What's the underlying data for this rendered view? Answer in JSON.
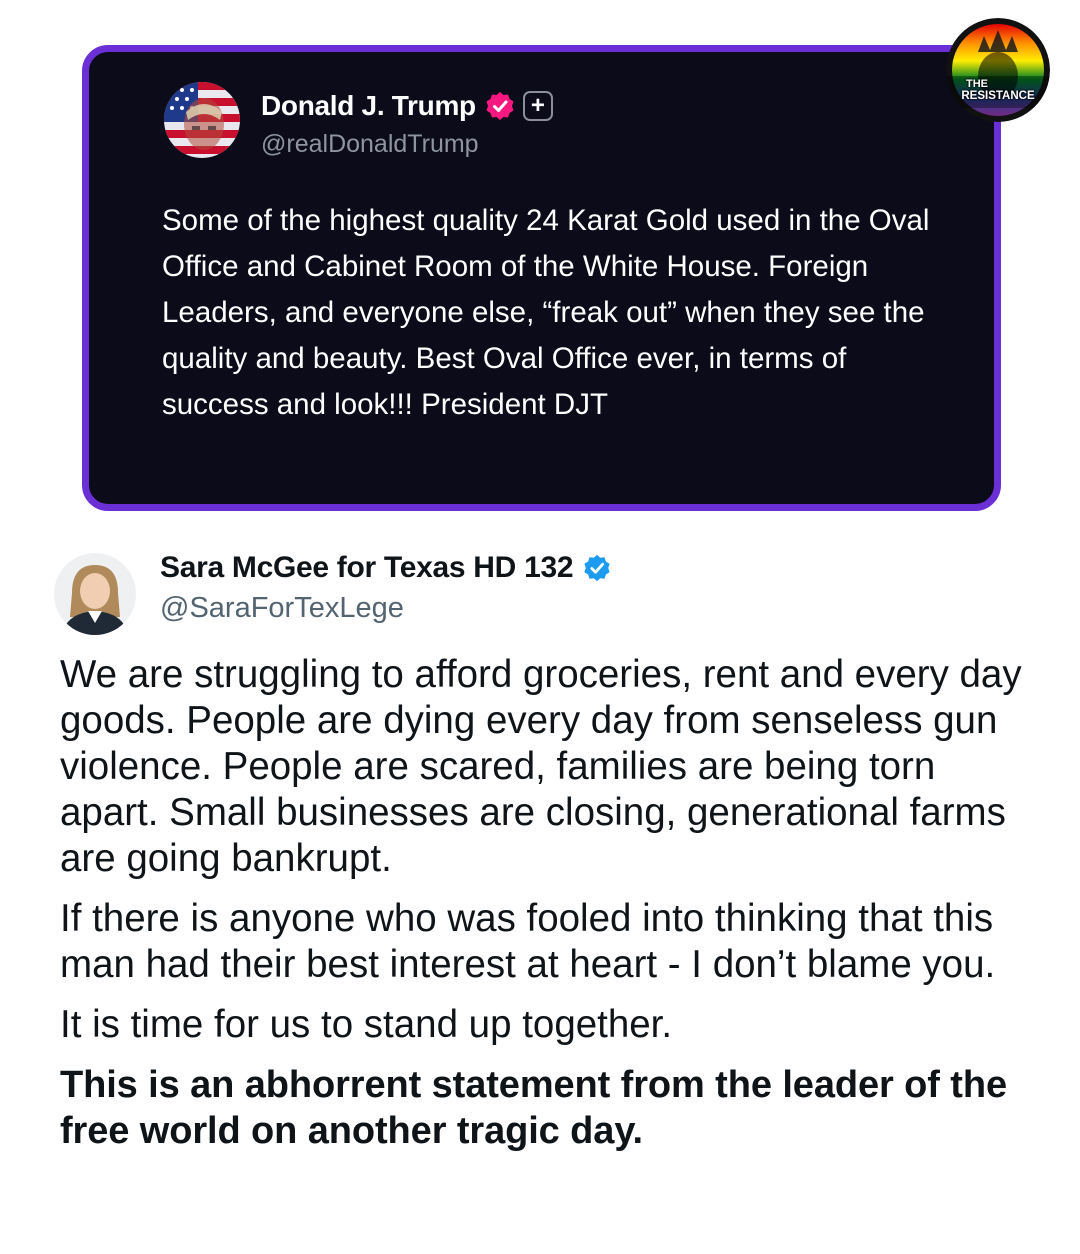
{
  "quoted_post": {
    "author_name": "Donald J. Trump",
    "author_handle": "@realDonaldTrump",
    "avatar_icon": "flag-portrait-avatar",
    "verified_icon": "verified-badge-icon",
    "verified_color": "#f91880",
    "follow_icon": "plus-icon",
    "text": "Some of the highest quality 24 Karat Gold used in the Oval Office and Cabinet Room of the White House. Foreign Leaders, and everyone else, “freak out” when they see the quality and beauty. Best Oval Office ever, in terms of success and look!!! President DJT",
    "card_border_color": "#6b2fd6",
    "card_background": "#0b0b1a"
  },
  "watermark": {
    "line1": "THE",
    "line2": "RESISTANCE",
    "icon": "statue-of-liberty-logo"
  },
  "post": {
    "author_name": "Sara McGee for Texas HD 132",
    "author_handle": "@SaraForTexLege",
    "avatar_icon": "profile-photo-avatar",
    "verified_icon": "verified-badge-icon",
    "verified_color": "#1d9bf0",
    "paragraphs": [
      "We are struggling to afford groceries, rent and every day goods. People are dying every day from senseless gun violence. People are scared, families are being torn apart. Small businesses are closing, generational farms are going bankrupt.",
      "If there is anyone who was fooled into thinking that this man had their best interest at heart - I don’t blame you.",
      "It is time for us to stand up together.",
      "This is an abhorrent statement from the leader of the free world on another tragic day."
    ]
  }
}
